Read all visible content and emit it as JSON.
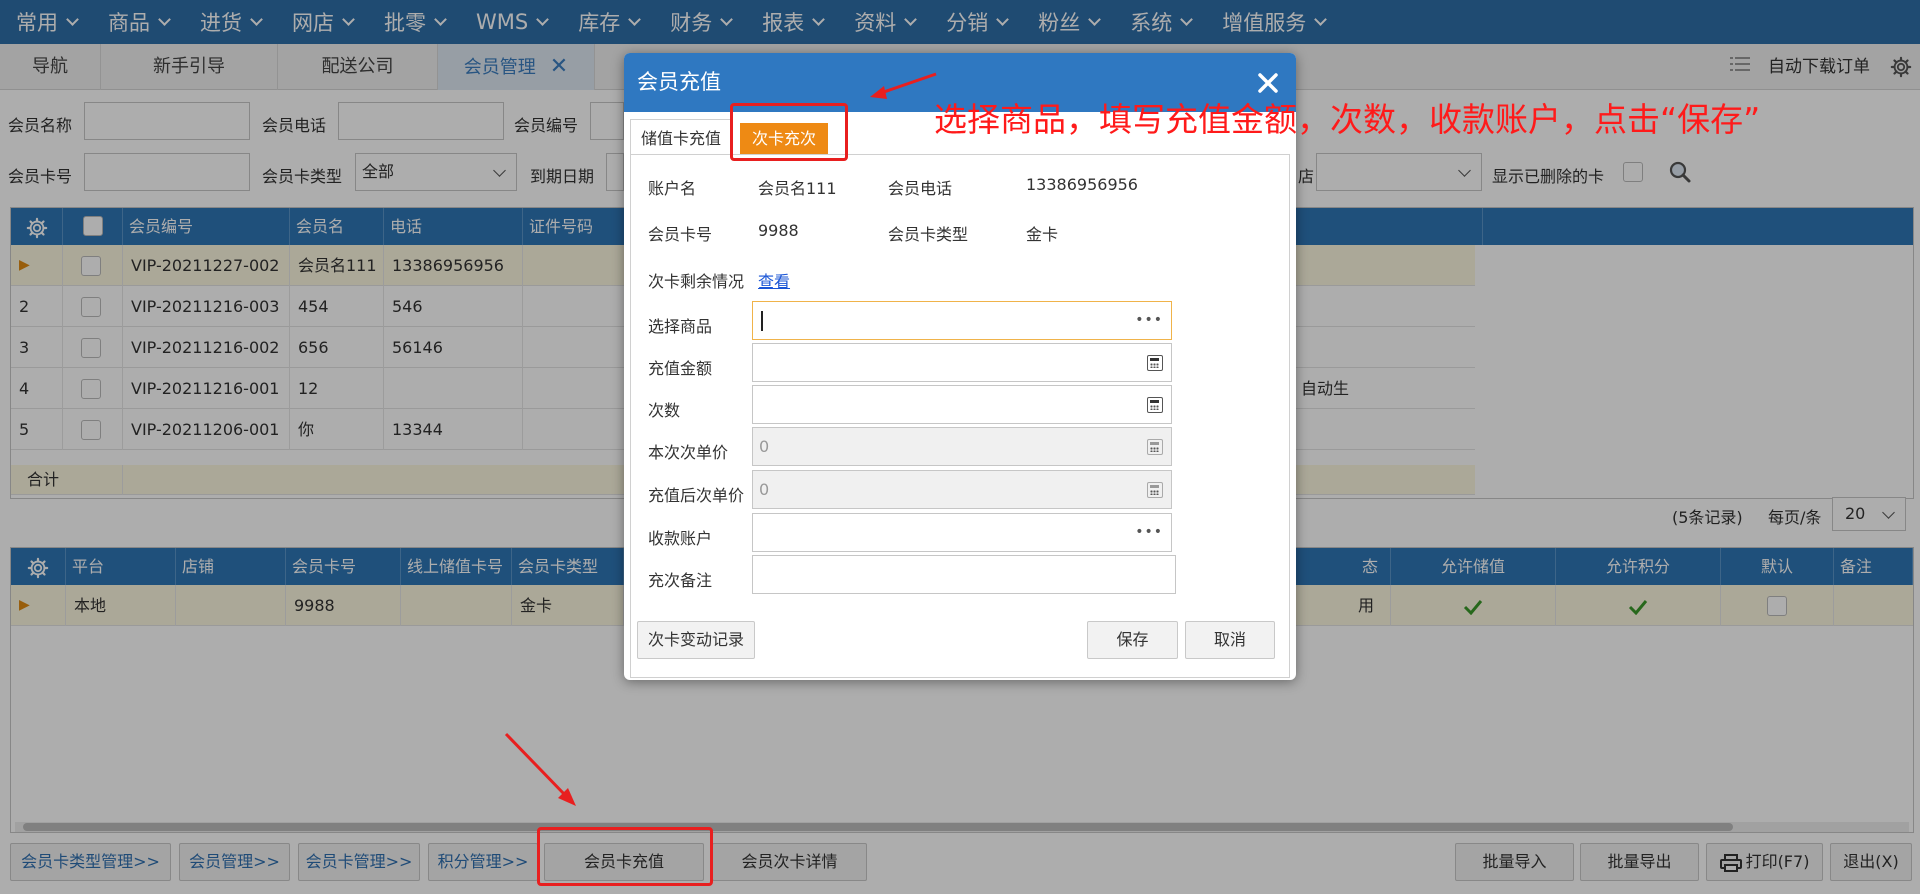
{
  "menu": [
    "常用",
    "商品",
    "进货",
    "网店",
    "批零",
    "WMS",
    "库存",
    "财务",
    "报表",
    "资料",
    "分销",
    "粉丝",
    "系统",
    "增值服务"
  ],
  "tabs": [
    "导航",
    "新手引导",
    "配送公司",
    "会员管理"
  ],
  "tabbar_right": {
    "auto_download": "自动下载订单"
  },
  "filters": {
    "row1": [
      "会员名称",
      "会员电话",
      "会员编号"
    ],
    "row2": {
      "card_no": "会员卡号",
      "card_type": "会员卡类型",
      "card_type_value": "全部",
      "expire": "到期日期",
      "cut_label": "店",
      "show_deleted": "显示已删除的卡"
    }
  },
  "grid1": {
    "headers": [
      "会员编号",
      "会员名",
      "电话",
      "证件号码"
    ],
    "rows": [
      {
        "idx": "▶",
        "no": "VIP-20211227-002",
        "name": "会员名111",
        "phone": "13386956956",
        "extra": ""
      },
      {
        "idx": "2",
        "no": "VIP-20211216-003",
        "name": "454",
        "phone": "546",
        "extra": ""
      },
      {
        "idx": "3",
        "no": "VIP-20211216-002",
        "name": "656",
        "phone": "56146",
        "extra": ""
      },
      {
        "idx": "4",
        "no": "VIP-20211216-001",
        "name": "12",
        "phone": "",
        "extra": "自动生"
      },
      {
        "idx": "5",
        "no": "VIP-20211206-001",
        "name": "你",
        "phone": "13344",
        "extra": ""
      }
    ],
    "total_label": "合计",
    "records": "(5条记录)",
    "page_size_label": "每页/条",
    "page_size": "20"
  },
  "grid2": {
    "headers": [
      "平台",
      "店铺",
      "会员卡号",
      "线上储值卡号",
      "会员卡类型",
      "态",
      "允许储值",
      "允许积分",
      "默认",
      "备注"
    ],
    "row": {
      "platform": "本地",
      "card_no": "9988",
      "card_type": "金卡",
      "status": "用"
    }
  },
  "footer": {
    "left": [
      "会员卡类型管理>>",
      "会员管理>>",
      "会员卡管理>>",
      "积分管理>>",
      "会员卡充值",
      "会员次卡详情"
    ],
    "right": [
      "批量导入",
      "批量导出",
      "打印(F7)",
      "退出(X)"
    ]
  },
  "dialog": {
    "title": "会员充值",
    "tabs": [
      "储值卡充值",
      "次卡充次"
    ],
    "info": {
      "account_label": "账户名",
      "account": "会员名111",
      "phone_label": "会员电话",
      "phone": "13386956956",
      "card_label": "会员卡号",
      "card": "9988",
      "type_label": "会员卡类型",
      "type": "金卡"
    },
    "remain_label": "次卡剩余情况",
    "remain_link": "查看",
    "fields": [
      "选择商品",
      "充值金额",
      "次数",
      "本次次单价",
      "充值后次单价",
      "收款账户",
      "充次备注"
    ],
    "unit_price": "0",
    "after_price": "0",
    "buttons": {
      "history": "次卡变动记录",
      "save": "保存",
      "cancel": "取消"
    }
  },
  "annotation": "选择商品，填写充值金额，次数，收款账户，点击“保存”",
  "colors": {
    "header_blue": "#2f6fa8",
    "grid_head": "#2f77b6",
    "accent_orange": "#ee8a14",
    "annotation_red": "#e81f1f"
  }
}
